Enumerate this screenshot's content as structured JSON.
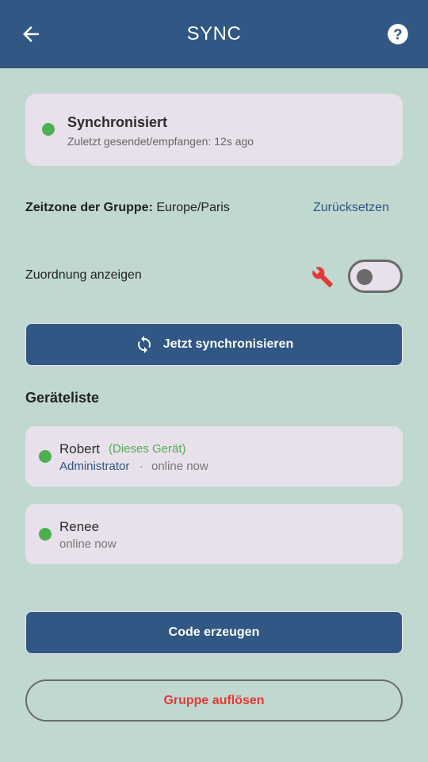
{
  "appbar": {
    "title": "SYNC",
    "back_icon": "arrow-left-icon",
    "help_icon": "help-circle-icon"
  },
  "status": {
    "title": "Synchronisiert",
    "subtitle": "Zuletzt gesendet/empfangen: 12s ago",
    "color": "#4caf50"
  },
  "timezone": {
    "label": "Zeitzone der Gruppe:",
    "value": " Europe/Paris",
    "reset_label": "Zurücksetzen"
  },
  "assignment": {
    "label": "Zuordnung anzeigen",
    "icon": "wrench-icon",
    "toggle_on": false
  },
  "sync_button": {
    "label": "Jetzt synchronisieren",
    "icon": "sync-icon"
  },
  "devices": {
    "title": "Geräteliste",
    "items": [
      {
        "name": "Robert",
        "tag": "(Dieses Gerät)",
        "role": "Administrator",
        "separator": "·",
        "status": "online now"
      },
      {
        "name": "Renee",
        "status": "online now"
      }
    ]
  },
  "code_button": {
    "label": "Code erzeugen"
  },
  "dissolve_button": {
    "label": "Gruppe auflösen"
  },
  "colors": {
    "primary": "#315784",
    "background": "#c0d8d0",
    "card": "#e8e0ea",
    "danger": "#e53935",
    "online": "#4caf50"
  }
}
